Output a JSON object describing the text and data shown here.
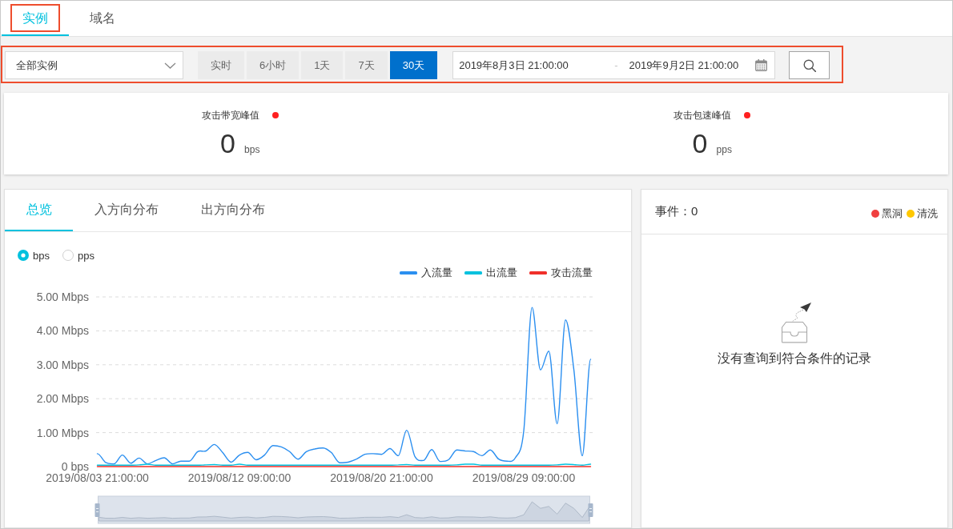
{
  "page_tabs": [
    {
      "label": "实例",
      "selected": true,
      "highlighted": true
    },
    {
      "label": "域名",
      "selected": false,
      "highlighted": false
    }
  ],
  "toolbar": {
    "highlighted": true,
    "instance_select": {
      "value": "全部实例"
    },
    "time_ranges": [
      {
        "label": "实时",
        "selected": false
      },
      {
        "label": "6小时",
        "selected": false
      },
      {
        "label": "1天",
        "selected": false
      },
      {
        "label": "7天",
        "selected": false
      },
      {
        "label": "30天",
        "selected": true
      }
    ],
    "date_range": {
      "start": "2019年8月3日 21:00:00",
      "separator": "-",
      "end": "2019年9月2日 21:00:00"
    }
  },
  "peak_stats": [
    {
      "label": "攻击带宽峰值",
      "value": "0",
      "unit": "bps"
    },
    {
      "label": "攻击包速峰值",
      "value": "0",
      "unit": "pps"
    }
  ],
  "traffic_panel": {
    "tabs": [
      {
        "label": "总览",
        "selected": true
      },
      {
        "label": "入方向分布",
        "selected": false
      },
      {
        "label": "出方向分布",
        "selected": false
      }
    ],
    "units": [
      {
        "label": "bps",
        "selected": true
      },
      {
        "label": "pps",
        "selected": false
      }
    ],
    "chart_data": {
      "type": "line",
      "categories": [
        "2019/08/03 21:00:00",
        null,
        null,
        null,
        null,
        null,
        null,
        null,
        null,
        null,
        null,
        null,
        null,
        null,
        null,
        null,
        null,
        "2019/08/12 09:00:00",
        null,
        null,
        null,
        null,
        null,
        null,
        null,
        null,
        null,
        null,
        null,
        null,
        null,
        null,
        null,
        null,
        "2019/08/20 21:00:00",
        null,
        null,
        null,
        null,
        null,
        null,
        null,
        null,
        null,
        null,
        null,
        null,
        null,
        null,
        null,
        null,
        "2019/08/29 09:00:00",
        null,
        null,
        null,
        null,
        null,
        null,
        null,
        null
      ],
      "series": [
        {
          "name": "入流量",
          "color": "#2b8ff0",
          "values": [
            0.38,
            0.12,
            0.08,
            0.34,
            0.1,
            0.25,
            0.08,
            0.18,
            0.26,
            0.08,
            0.16,
            0.16,
            0.44,
            0.46,
            0.65,
            0.41,
            0.13,
            0.34,
            0.42,
            0.2,
            0.34,
            0.62,
            0.58,
            0.44,
            0.22,
            0.44,
            0.52,
            0.55,
            0.41,
            0.11,
            0.13,
            0.22,
            0.36,
            0.38,
            0.36,
            0.53,
            0.32,
            1.07,
            0.29,
            0.18,
            0.5,
            0.15,
            0.2,
            0.49,
            0.46,
            0.44,
            0.32,
            0.49,
            0.22,
            0.16,
            0.26,
            1.05,
            4.69,
            2.85,
            3.4,
            1.26,
            4.32,
            2.85,
            0.32,
            3.16
          ]
        },
        {
          "name": "出流量",
          "color": "#00c1de",
          "values": [
            0.04,
            0.04,
            0.04,
            0.04,
            0.04,
            0.05,
            0.07,
            0.04,
            0.04,
            0.04,
            0.04,
            0.04,
            0.04,
            0.05,
            0.06,
            0.04,
            0.04,
            0.07,
            0.04,
            0.04,
            0.04,
            0.04,
            0.04,
            0.04,
            0.04,
            0.04,
            0.04,
            0.04,
            0.04,
            0.04,
            0.04,
            0.04,
            0.04,
            0.04,
            0.04,
            0.04,
            0.05,
            0.06,
            0.04,
            0.04,
            0.04,
            0.04,
            0.04,
            0.05,
            0.07,
            0.07,
            0.04,
            0.04,
            0.04,
            0.04,
            0.04,
            0.04,
            0.04,
            0.04,
            0.04,
            0.05,
            0.07,
            0.06,
            0.04,
            0.07
          ]
        },
        {
          "name": "攻击流量",
          "color": "#f0302a",
          "values": [
            0,
            0,
            0,
            0,
            0,
            0,
            0,
            0,
            0,
            0,
            0,
            0,
            0,
            0,
            0,
            0,
            0,
            0,
            0,
            0,
            0,
            0,
            0,
            0,
            0,
            0,
            0,
            0,
            0,
            0,
            0,
            0,
            0,
            0,
            0,
            0,
            0,
            0,
            0,
            0,
            0,
            0,
            0,
            0,
            0,
            0,
            0,
            0,
            0,
            0,
            0,
            0,
            0,
            0,
            0,
            0,
            0,
            0,
            0,
            0
          ]
        }
      ],
      "ylim": [
        0,
        5
      ],
      "grid": true,
      "legend": "top-right",
      "yticks": [
        {
          "value": 0,
          "label": "0 bps"
        },
        {
          "value": 1,
          "label": "1.00 Mbps"
        },
        {
          "value": 2,
          "label": "2.00 Mbps"
        },
        {
          "value": 3,
          "label": "3.00 Mbps"
        },
        {
          "value": 4,
          "label": "4.00 Mbps"
        },
        {
          "value": 5,
          "label": "5.00 Mbps"
        }
      ]
    }
  },
  "events_panel": {
    "title": "事件：0",
    "legend": [
      {
        "label": "黑洞",
        "color": "#f04040"
      },
      {
        "label": "清洗",
        "color": "#ffc800"
      }
    ],
    "empty_message": "没有查询到符合条件的记录"
  }
}
